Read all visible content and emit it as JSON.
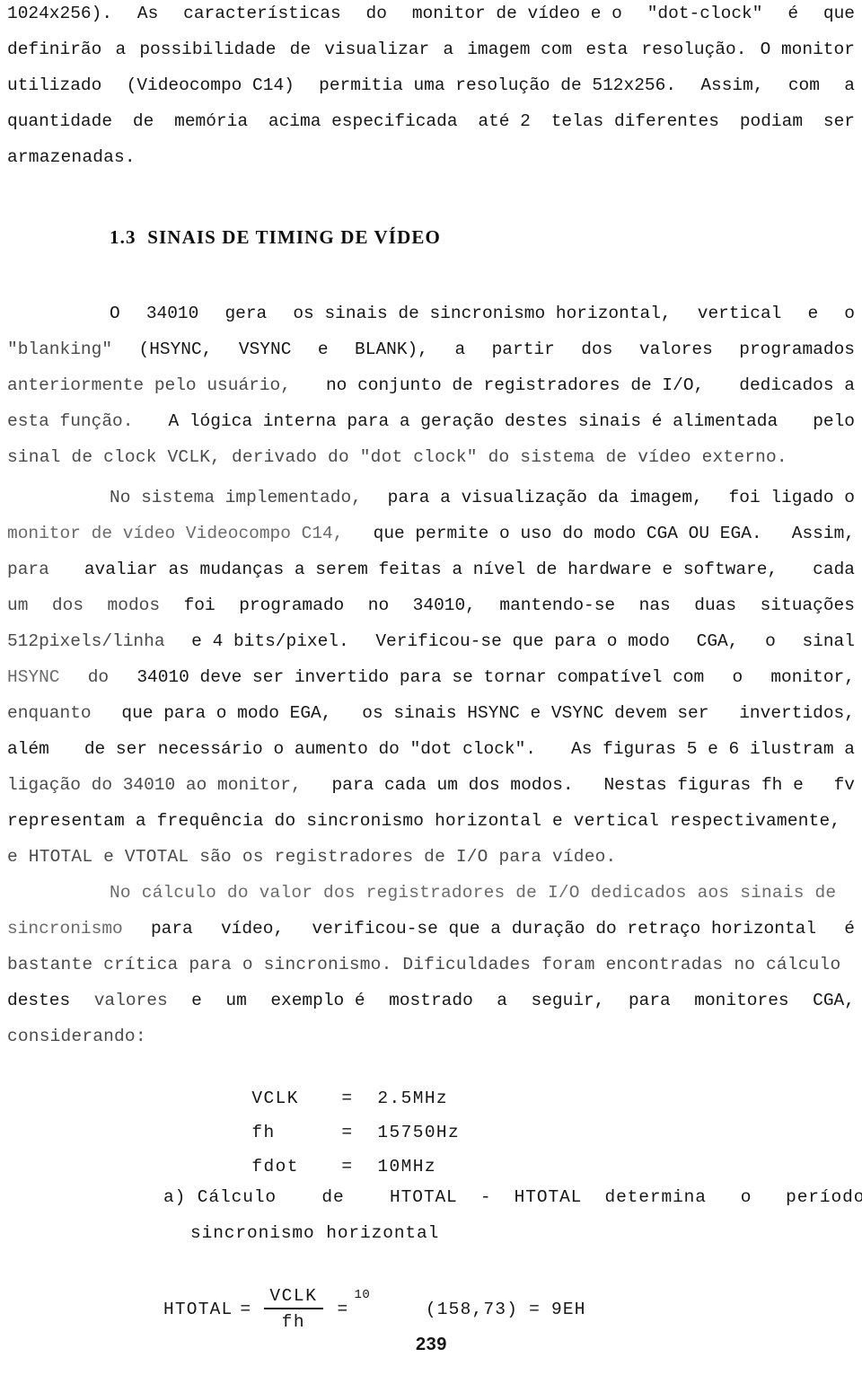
{
  "document": {
    "page_number": "239",
    "language": "pt-BR",
    "section_heading": "1.3  SINAIS DE TIMING DE VÍDEO"
  },
  "paragraph_1": {
    "lines": [
      [
        "1024x256).",
        "As",
        "características",
        "do",
        "monitor de vídeo e o",
        "\"dot-clock\"",
        "é",
        "que"
      ],
      [
        "definirão",
        "a",
        "possibilidade",
        "de",
        "visualizar",
        "a",
        "imagem com",
        "esta",
        "resolução.",
        "O monitor"
      ],
      [
        "utilizado",
        "(Videocompo C14)",
        "permitia uma resolução de 512x256.",
        "Assim,",
        "com",
        "a"
      ],
      [
        "quantidade",
        "de",
        "memória",
        "acima especificada",
        "até 2",
        "telas diferentes",
        "podiam",
        "ser"
      ],
      [
        "armazenadas."
      ]
    ]
  },
  "paragraph_2": {
    "lines": [
      [
        "O",
        "34010",
        "gera",
        "os sinais de sincronismo horizontal,",
        "vertical",
        "e",
        "o"
      ],
      [
        "\"blanking\"",
        "(HSYNC,",
        "VSYNC",
        "e",
        "BLANK),",
        "a",
        "partir",
        "dos",
        "valores",
        "programados"
      ],
      [
        "anteriormente pelo usuário,",
        "no conjunto de registradores de I/O,",
        "dedicados a"
      ],
      [
        "esta função.",
        "A lógica interna para a geração destes sinais é alimentada",
        "pelo"
      ],
      [
        "sinal de clock VCLK, derivado do \"dot clock\" do sistema de vídeo externo."
      ]
    ]
  },
  "paragraph_3": {
    "lines": [
      [
        "No sistema implementado,",
        "para a visualização da imagem,",
        "foi ligado o"
      ],
      [
        "monitor de vídeo Videocompo C14,",
        "que permite o uso do modo CGA OU EGA.",
        "Assim,"
      ],
      [
        "para",
        "avaliar as mudanças a serem feitas a nível de hardware e software,",
        "cada"
      ],
      [
        "um",
        "dos",
        "modos",
        "foi",
        "programado",
        "no",
        "34010,",
        "mantendo-se",
        "nas",
        "duas",
        "situações"
      ],
      [
        "512pixels/linha",
        "e 4 bits/pixel.",
        "Verificou-se que para o modo",
        "CGA,",
        "o",
        "sinal"
      ],
      [
        "HSYNC",
        "do",
        "34010 deve ser invertido para se tornar compatível com",
        "o",
        "monitor,"
      ],
      [
        "enquanto",
        "que para o modo EGA,",
        "os sinais HSYNC e VSYNC devem ser",
        "invertidos,"
      ],
      [
        "além",
        "de ser necessário o aumento do \"dot clock\".",
        "As figuras 5 e 6 ilustram a"
      ],
      [
        "ligação do 34010 ao monitor,",
        "para cada um dos modos.",
        "Nestas figuras fh e",
        "fv"
      ],
      [
        "representam a frequência do sincronismo horizontal e vertical respectivamente,"
      ],
      [
        "e HTOTAL e VTOTAL são os registradores de I/O para vídeo."
      ]
    ]
  },
  "paragraph_4": {
    "lines": [
      [
        "No cálculo do valor dos registradores de I/O dedicados aos sinais de"
      ],
      [
        "sincronismo",
        "para",
        "vídeo,",
        "verificou-se que a duração do retraço horizontal",
        "é"
      ],
      [
        "bastante crítica para o sincronismo. Dificuldades foram encontradas no cálculo"
      ],
      [
        "destes",
        "valores",
        "e",
        "um",
        "exemplo é",
        "mostrado",
        "a",
        "seguir,",
        "para",
        "monitores",
        "CGA,"
      ],
      [
        "considerando:"
      ]
    ]
  },
  "constants": [
    {
      "name": "VCLK",
      "eq": "=",
      "value": "2.5MHz"
    },
    {
      "name": "fh",
      "eq": "=",
      "value": "15750Hz"
    },
    {
      "name": "fdot",
      "eq": "=",
      "value": "10MHz"
    }
  ],
  "sub_item_a": {
    "line1": "a) Cálculo    de    HTOTAL  -  HTOTAL  determina   o   período   do",
    "line2": "sincronismo horizontal"
  },
  "equation": {
    "lhs": "HTOTAL",
    "eq1": "=",
    "numerator": "VCLK",
    "denominator": "fh",
    "eq2": "=",
    "decimal_value": "(158,73)",
    "decimal_base": "10",
    "eq3": "=",
    "hex_value": "9EH"
  }
}
